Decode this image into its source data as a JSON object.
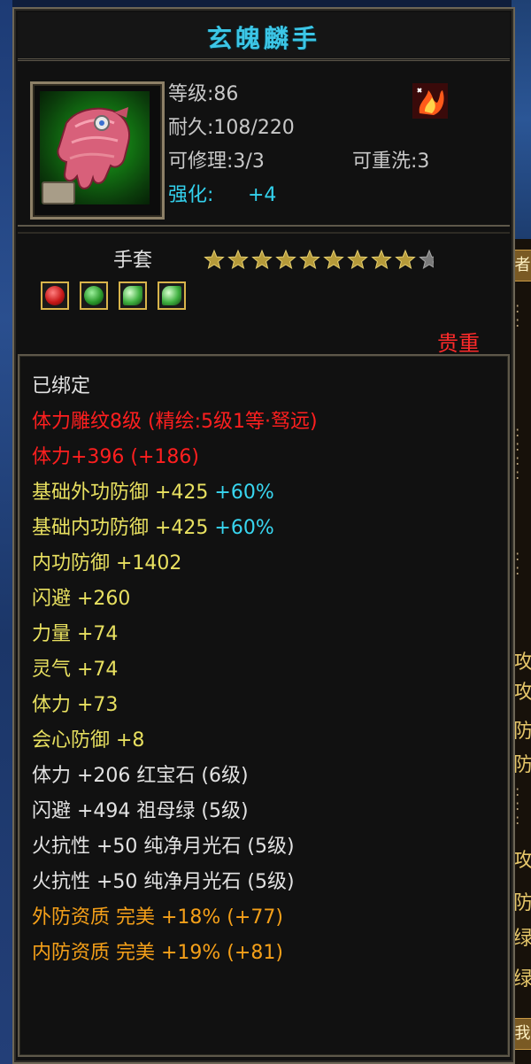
{
  "item": {
    "title": "玄魄麟手",
    "level": "等级:86",
    "durability": "耐久:108/220",
    "repair": "可修理:3/3",
    "rewash": "可重洗:3",
    "enhance_label": "强化:",
    "enhance_value": "+4",
    "type": "手套",
    "stars_total": 10,
    "stars_filled": 9,
    "rarity": "贵重",
    "gems": [
      {
        "icon": "ruby-gem-icon",
        "color": "#c81818"
      },
      {
        "icon": "emerald-gem-icon",
        "color": "#2c9a2c"
      },
      {
        "icon": "moonstone-gem-icon",
        "color": "#3fb040"
      },
      {
        "icon": "moonstone-gem-icon",
        "color": "#3fb040"
      }
    ]
  },
  "attributes": {
    "bound": "已绑定",
    "engrave": "体力雕纹8级 (精绘:5级1等·驽远)",
    "stamina_engrave": "体力+396 (+186)",
    "base_ext_def": "基础外功防御 +425",
    "base_ext_def_pct": "+60%",
    "base_int_def": "基础内功防御 +425",
    "base_int_def_pct": "+60%",
    "int_def": "内功防御 +1402",
    "dodge": "闪避 +260",
    "strength": "力量 +74",
    "spirit": "灵气 +74",
    "stamina": "体力 +73",
    "crit_def": "会心防御 +8",
    "gem_line_1": "体力 +206 红宝石 (6级)",
    "gem_line_2": "闪避 +494 祖母绿 (5级)",
    "gem_line_3": "火抗性 +50 纯净月光石 (5级)",
    "gem_line_4": "火抗性 +50 纯净月光石 (5级)",
    "aptitude_ext": "外防资质 完美 +18% (+77)",
    "aptitude_int": "内防资质 完美 +19% (+81)"
  },
  "side_panel": {
    "chars": [
      "攻",
      "攻",
      "防",
      "防",
      "攻",
      "防",
      "绿",
      "绿",
      "我"
    ]
  },
  "colors": {
    "title": "#3cc6e6",
    "enhance": "#33d2ee",
    "rarity": "#ff2a2a",
    "red_attr": "#ff1f1f",
    "yellow_attr": "#e8e060",
    "orange_attr": "#f5a019"
  }
}
